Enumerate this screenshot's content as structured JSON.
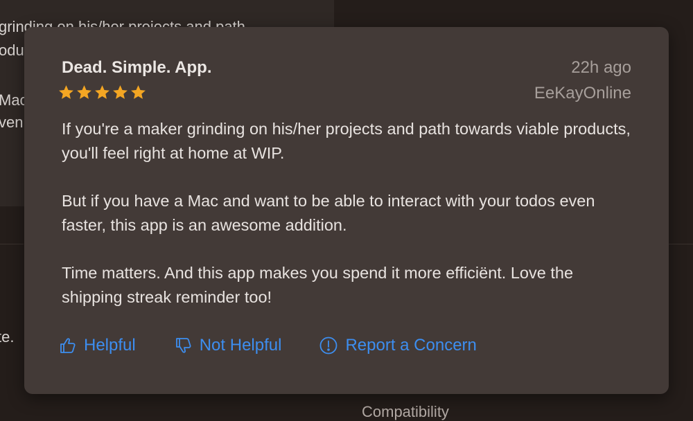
{
  "background": {
    "line1": "grinding on his/her projects and path",
    "line2": "odu",
    "line3": "Mac",
    "line4": "ven",
    "side_text": "te.",
    "compat_label": "Compatibility"
  },
  "review": {
    "title": "Dead. Simple. App.",
    "date": "22h ago",
    "author": "EeKayOnline",
    "rating": 5,
    "star_color": "#f4a623",
    "paragraphs": [
      "If you're a maker grinding on his/her projects and path towards viable products, you'll feel right at home at WIP.",
      "But if you have a Mac and want to be able to interact with your todos even faster, this app is an awesome addition.",
      "Time matters. And this app makes you spend it more efficiënt. Love the shipping streak reminder too!"
    ]
  },
  "actions": {
    "helpful": "Helpful",
    "not_helpful": "Not Helpful",
    "report": "Report a Concern",
    "link_color": "#3d8ef0",
    "helpful_icon": "thumbs-up-icon",
    "not_helpful_icon": "thumbs-down-icon",
    "report_icon": "exclamation-circle-icon"
  }
}
